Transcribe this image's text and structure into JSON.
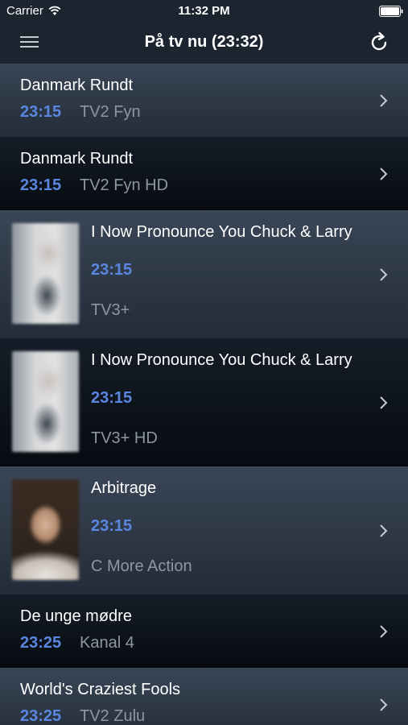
{
  "status_bar": {
    "carrier": "Carrier",
    "time": "11:32 PM"
  },
  "nav": {
    "title": "På tv nu (23:32)",
    "left_icon": "hamburger-menu-icon",
    "right_icon": "refresh-icon"
  },
  "colors": {
    "accent_time": "#5b86e0",
    "channel_text": "#8d96a2",
    "bar_background": "#1c2430"
  },
  "programs": [
    {
      "title": "Danmark Rundt",
      "time": "23:15",
      "channel": "TV2 Fyn"
    },
    {
      "title": "Danmark Rundt",
      "time": "23:15",
      "channel": "TV2 Fyn HD"
    },
    {
      "title": "I Now Pronounce You Chuck & Larry",
      "time": "23:15",
      "channel": "TV3+"
    },
    {
      "title": "I Now Pronounce You Chuck & Larry",
      "time": "23:15",
      "channel": "TV3+ HD"
    },
    {
      "title": "Arbitrage",
      "time": "23:15",
      "channel": "C More Action"
    },
    {
      "title": "De unge mødre",
      "time": "23:25",
      "channel": "Kanal 4"
    },
    {
      "title": "World's Craziest Fools",
      "time": "23:25",
      "channel": "TV2 Zulu"
    }
  ]
}
